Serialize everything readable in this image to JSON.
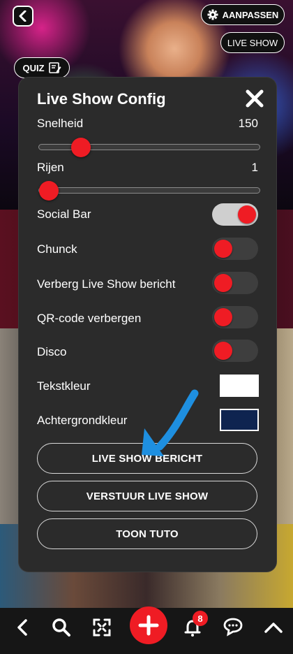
{
  "header": {
    "customize_label": "AANPASSEN",
    "live_show_label": "LIVE SHOW",
    "quiz_label": "QUIZ"
  },
  "modal": {
    "title": "Live Show Config",
    "sliders": [
      {
        "label": "Snelheid",
        "value": "150",
        "fraction": 0.16
      },
      {
        "label": "Rijen",
        "value": "1",
        "fraction": 0.0
      }
    ],
    "toggles": [
      {
        "label": "Social Bar",
        "on": true
      },
      {
        "label": "Chunck",
        "on": false
      },
      {
        "label": "Verberg Live Show bericht",
        "on": false
      },
      {
        "label": "QR-code verbergen",
        "on": false
      },
      {
        "label": "Disco",
        "on": false
      }
    ],
    "colors": [
      {
        "label": "Tekstkleur",
        "color": "#ffffff"
      },
      {
        "label": "Achtergrondkleur",
        "color": "#0e2450"
      }
    ],
    "buttons": [
      {
        "label": "LIVE SHOW BERICHT"
      },
      {
        "label": "VERSTUUR LIVE SHOW"
      },
      {
        "label": "TOON TUTO"
      }
    ]
  },
  "nav": {
    "notification_count": "8"
  },
  "colors": {
    "accent": "#ef1c24",
    "modal_bg": "#2b2b2b",
    "arrow": "#1e8fe0"
  }
}
